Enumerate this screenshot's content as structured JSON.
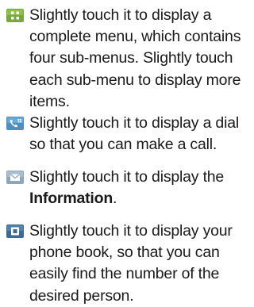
{
  "items": [
    {
      "icon": "menu-grid-icon",
      "text": "Slightly touch it to display a complete menu, which contains four sub-menus. Slightly touch each sub-menu to display more items."
    },
    {
      "icon": "phone-dial-icon",
      "text": "Slightly touch it to display a dial so that you can make a call."
    },
    {
      "icon": "envelope-icon",
      "text_before": "Slightly touch it to display the ",
      "text_bold": "Information",
      "text_after": "."
    },
    {
      "icon": "phonebook-icon",
      "text": "Slightly touch it to display your phone book, so that you can easily find the number of the desired person."
    }
  ],
  "colors": {
    "menu_icon": "#79a83a",
    "phone_icon": "#4f8fbf",
    "envelope_icon": "#8ea6bd",
    "phonebook_icon": "#3c6a92",
    "text": "#1a1a1a"
  }
}
